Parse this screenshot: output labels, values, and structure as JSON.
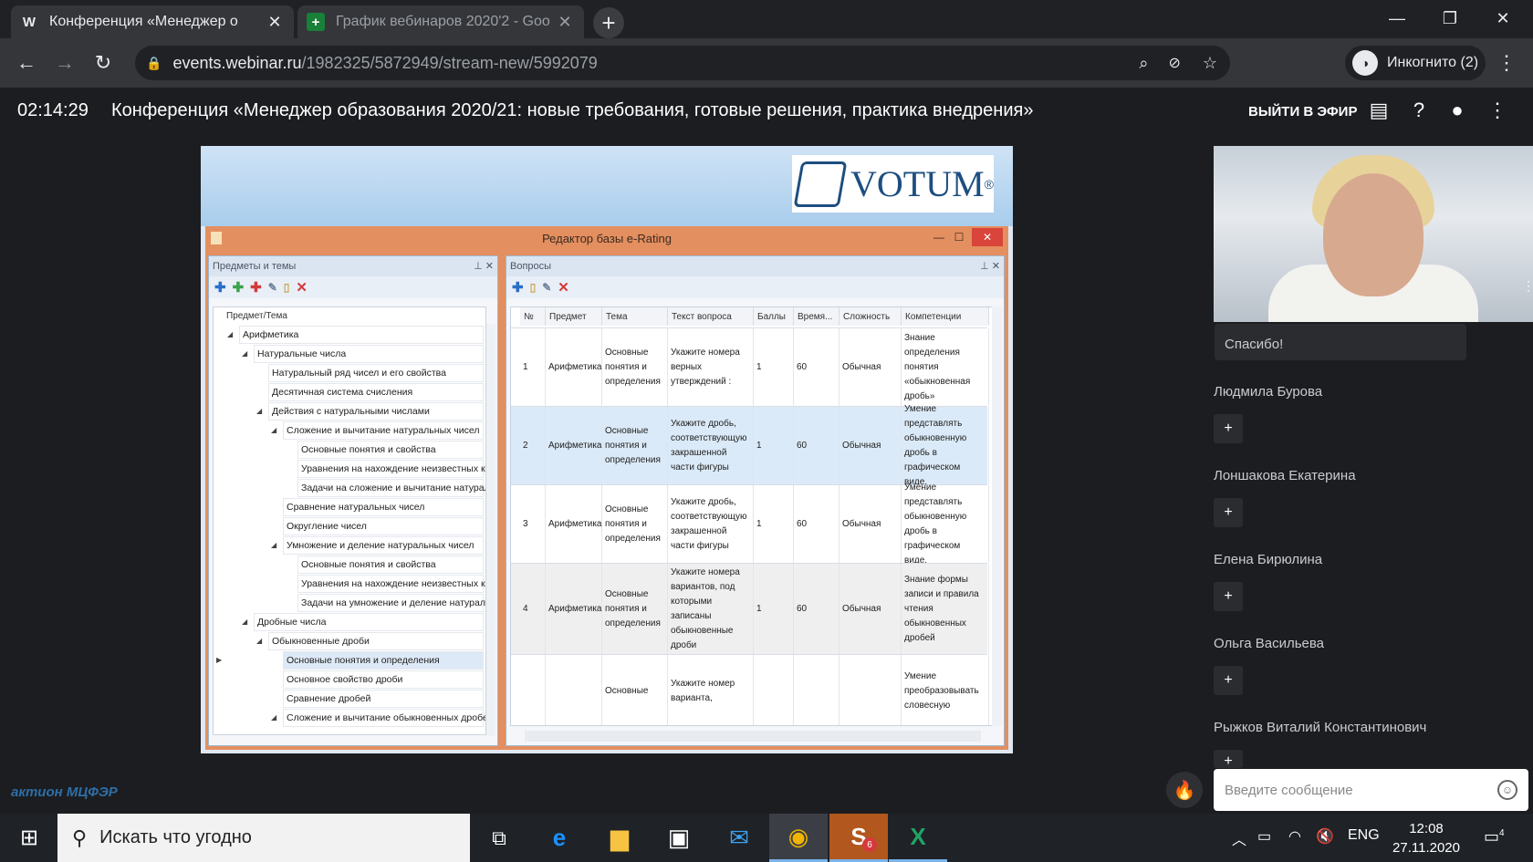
{
  "browser": {
    "tabs": [
      {
        "favicon": "W",
        "title": "Конференция «Менеджер о"
      },
      {
        "favicon": "+",
        "title": "График вебинаров 2020'2 - Goo"
      }
    ],
    "url_host": "events.webinar.ru",
    "url_path": "/1982325/5872949/stream-new/5992079",
    "profile_label": "Инкогнито (2)"
  },
  "webinar": {
    "time": "02:14:29",
    "title": "Конференция «Менеджер образования 2020/21: новые требования, готовые решения, практика внедрения»",
    "go_live": "ВЫЙТИ В ЭФИР"
  },
  "slide": {
    "logo": "VOTUM",
    "logo_mark": "®",
    "app_title": "Редактор базы e-Rating",
    "tree_pane_title": "Предметы и темы",
    "questions_pane_title": "Вопросы",
    "tree_header": "Предмет/Тема",
    "tree_items": [
      {
        "level": 0,
        "label": "Арифметика",
        "expanded": true
      },
      {
        "level": 1,
        "label": "Натуральные числа",
        "expanded": true
      },
      {
        "level": 2,
        "label": "Натуральный ряд чисел и его свойства"
      },
      {
        "level": 2,
        "label": "Десятичная система счисления"
      },
      {
        "level": 2,
        "label": "Действия с натуральными числами",
        "expanded": true
      },
      {
        "level": 3,
        "label": "Сложение и вычитание натуральных чисел",
        "expanded": true
      },
      {
        "level": 4,
        "label": "Основные понятия и свойства"
      },
      {
        "level": 4,
        "label": "Уравнения на нахождение неизвестных к..."
      },
      {
        "level": 4,
        "label": "Задачи на сложение и вычитание натурал..."
      },
      {
        "level": 3,
        "label": "Сравнение натуральных чисел"
      },
      {
        "level": 3,
        "label": "Округление чисел"
      },
      {
        "level": 3,
        "label": "Умножение и деление натуральных чисел",
        "expanded": true
      },
      {
        "level": 4,
        "label": "Основные понятия и свойства"
      },
      {
        "level": 4,
        "label": "Уравнения на нахождение неизвестных к..."
      },
      {
        "level": 4,
        "label": "Задачи на умножение и деление натураль..."
      },
      {
        "level": 1,
        "label": "Дробные числа",
        "expanded": true
      },
      {
        "level": 2,
        "label": "Обыкновенные дроби",
        "expanded": true
      },
      {
        "level": 3,
        "label": "Основные понятия и определения",
        "selected": true
      },
      {
        "level": 3,
        "label": "Основное свойство дроби"
      },
      {
        "level": 3,
        "label": "Сравнение дробей"
      },
      {
        "level": 3,
        "label": "Сложение и вычитание обыкновенных дробей",
        "expanded": true
      }
    ],
    "grid_columns": [
      "№",
      "Предмет",
      "Тема",
      "Текст вопроса",
      "Баллы",
      "Время...",
      "Сложность",
      "Компетенции"
    ],
    "grid_rows": [
      {
        "num": "1",
        "subject": "Арифметика",
        "topic": "Основные понятия и определения",
        "text": "Укажите номера верных утверждений :",
        "points": "1",
        "time": "60",
        "difficulty": "Обычная",
        "competence": "Знание определения понятия «обыкновенная дробь»"
      },
      {
        "num": "2",
        "subject": "Арифметика",
        "topic": "Основные понятия и определения",
        "text": "Укажите дробь, соответствующую закрашенной части фигуры",
        "points": "1",
        "time": "60",
        "difficulty": "Обычная",
        "competence": "Умение представлять обыкновенную дробь в графическом виде."
      },
      {
        "num": "3",
        "subject": "Арифметика",
        "topic": "Основные понятия и определения",
        "text": "Укажите дробь, соответствующую закрашенной части фигуры",
        "points": "1",
        "time": "60",
        "difficulty": "Обычная",
        "competence": "Умение представлять обыкновенную дробь в графическом виде."
      },
      {
        "num": "4",
        "subject": "Арифметика",
        "topic": "Основные понятия и определения",
        "text": "Укажите номера вариантов, под которыми записаны обыкновенные дроби",
        "points": "1",
        "time": "60",
        "difficulty": "Обычная",
        "competence": "Знание формы записи и правила чтения обыкновенных дробей"
      },
      {
        "num": "",
        "subject": "",
        "topic": "Основные",
        "text": "Укажите номер варианта,",
        "points": "",
        "time": "",
        "difficulty": "",
        "competence": "Умение преобразовывать словесную"
      }
    ]
  },
  "sidebar": {
    "chat_snippet": "Спасибо!",
    "participants": [
      "Людмила Бурова",
      "Лоншакова Екатерина",
      "Елена Бирюлина",
      "Ольга Васильева",
      "Рыжков Виталий Константинович"
    ],
    "plus_label": "+",
    "message_placeholder": "Введите сообщение"
  },
  "org_logo": "актион МЦФЭР",
  "taskbar": {
    "search_placeholder": "Искать что угодно",
    "lang": "ENG",
    "time": "12:08",
    "date": "27.11.2020",
    "skype_badge": "6",
    "notif_badge": "4"
  }
}
